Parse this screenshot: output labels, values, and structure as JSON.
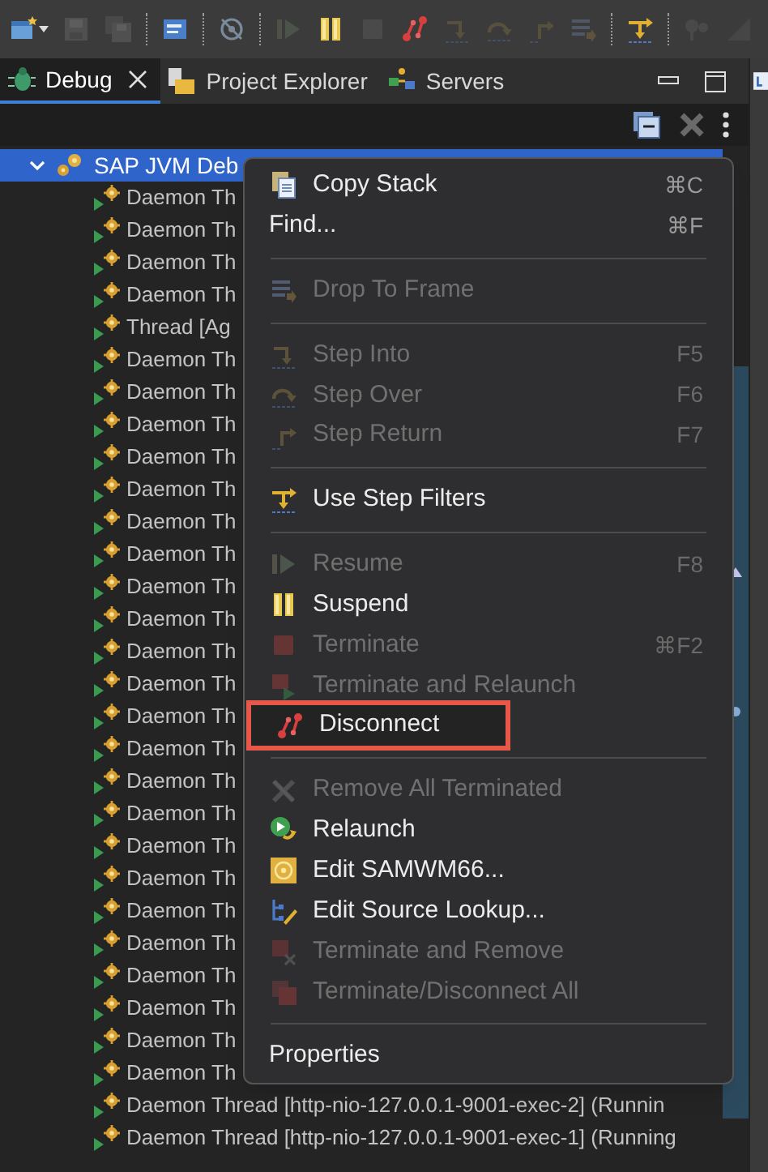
{
  "toolbar": {
    "buttons": [
      {
        "disabled": false
      },
      {
        "disabled": true
      },
      {
        "disabled": true
      },
      {
        "disabled": false
      },
      {
        "disabled": false
      },
      {
        "disabled": true
      },
      {
        "disabled": false
      },
      {
        "disabled": true
      },
      {
        "disabled": false
      },
      {
        "disabled": true
      },
      {
        "disabled": true
      },
      {
        "disabled": true
      },
      {
        "disabled": true
      },
      {
        "disabled": false
      },
      {
        "disabled": true
      },
      {
        "disabled": true
      }
    ]
  },
  "tabs": [
    {
      "label": "Debug",
      "selected": true,
      "closable": true
    },
    {
      "label": "Project Explorer",
      "selected": false,
      "closable": false
    },
    {
      "label": "Servers",
      "selected": false,
      "closable": false
    }
  ],
  "tree": {
    "label": "SAP JVM Deb",
    "expanded": true,
    "selected": true,
    "children": [
      {
        "label": "Daemon Th",
        "selected": false
      },
      {
        "label": "Daemon Th",
        "selected": false
      },
      {
        "label": "Daemon Th",
        "selected": false
      },
      {
        "label": "Daemon Th",
        "selected": false
      },
      {
        "label": "Thread [Ag",
        "selected": false
      },
      {
        "label": "Daemon Th",
        "selected": false
      },
      {
        "label": "Daemon Th",
        "selected": false
      },
      {
        "label": "Daemon Th",
        "selected": false
      },
      {
        "label": "Daemon Th",
        "selected": false
      },
      {
        "label": "Daemon Th",
        "selected": false
      },
      {
        "label": "Daemon Th",
        "selected": false
      },
      {
        "label": "Daemon Th",
        "selected": false
      },
      {
        "label": "Daemon Th",
        "selected": false
      },
      {
        "label": "Daemon Th",
        "selected": false
      },
      {
        "label": "Daemon Th",
        "selected": false
      },
      {
        "label": "Daemon Th",
        "selected": false
      },
      {
        "label": "Daemon Th",
        "selected": false
      },
      {
        "label": "Daemon Th",
        "selected": false
      },
      {
        "label": "Daemon Th",
        "selected": false
      },
      {
        "label": "Daemon Th",
        "selected": false
      },
      {
        "label": "Daemon Th",
        "selected": false
      },
      {
        "label": "Daemon Th",
        "selected": false
      },
      {
        "label": "Daemon Th",
        "selected": false
      },
      {
        "label": "Daemon Th",
        "selected": false
      },
      {
        "label": "Daemon Th",
        "selected": false
      },
      {
        "label": "Daemon Th",
        "selected": false
      },
      {
        "label": "Daemon Th",
        "selected": false
      },
      {
        "label": "Daemon Th",
        "selected": false
      },
      {
        "label": "Daemon Thread [http-nio-127.0.0.1-9001-exec-2] (Runnin",
        "selected": false
      },
      {
        "label": "Daemon Thread [http-nio-127.0.0.1-9001-exec-1] (Running",
        "selected": false
      }
    ]
  },
  "context_menu": [
    {
      "kind": "item",
      "label": "Copy Stack",
      "shortcut": "⌘C",
      "disabled": false,
      "highlighted": false
    },
    {
      "kind": "item",
      "label": "Find...",
      "shortcut": "⌘F",
      "disabled": false,
      "highlighted": false
    },
    {
      "kind": "separator"
    },
    {
      "kind": "item",
      "label": "Drop To Frame",
      "disabled": true,
      "highlighted": false
    },
    {
      "kind": "separator"
    },
    {
      "kind": "item",
      "label": "Step Into",
      "shortcut": "F5",
      "disabled": true,
      "highlighted": false
    },
    {
      "kind": "item",
      "label": "Step Over",
      "shortcut": "F6",
      "disabled": true,
      "highlighted": false
    },
    {
      "kind": "item",
      "label": "Step Return",
      "shortcut": "F7",
      "disabled": true,
      "highlighted": false
    },
    {
      "kind": "separator"
    },
    {
      "kind": "item",
      "label": "Use Step Filters",
      "disabled": false,
      "highlighted": false
    },
    {
      "kind": "separator"
    },
    {
      "kind": "item",
      "label": "Resume",
      "shortcut": "F8",
      "disabled": true,
      "highlighted": false
    },
    {
      "kind": "item",
      "label": "Suspend",
      "disabled": false,
      "highlighted": false
    },
    {
      "kind": "item",
      "label": "Terminate",
      "shortcut": "⌘F2",
      "disabled": true,
      "highlighted": false
    },
    {
      "kind": "item",
      "label": "Terminate and Relaunch",
      "disabled": true,
      "highlighted": false
    },
    {
      "kind": "item",
      "label": "Disconnect",
      "disabled": false,
      "highlighted": true
    },
    {
      "kind": "separator"
    },
    {
      "kind": "item",
      "label": "Remove All Terminated",
      "disabled": true,
      "highlighted": false
    },
    {
      "kind": "item",
      "label": "Relaunch",
      "disabled": false,
      "highlighted": false
    },
    {
      "kind": "item",
      "label": "Edit SAMWM66...",
      "disabled": false,
      "highlighted": false
    },
    {
      "kind": "item",
      "label": "Edit Source Lookup...",
      "disabled": false,
      "highlighted": false
    },
    {
      "kind": "item",
      "label": "Terminate and Remove",
      "disabled": true,
      "highlighted": false
    },
    {
      "kind": "item",
      "label": "Terminate/Disconnect All",
      "disabled": true,
      "highlighted": false
    },
    {
      "kind": "separator"
    },
    {
      "kind": "item",
      "label": "Properties",
      "disabled": false,
      "highlighted": false
    }
  ]
}
